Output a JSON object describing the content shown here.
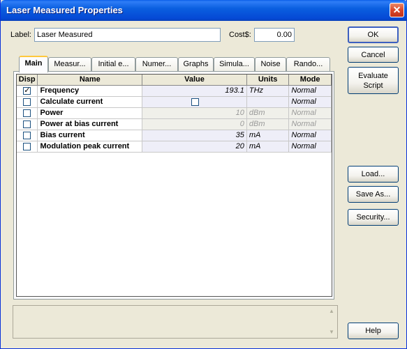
{
  "window": {
    "title": "Laser Measured Properties",
    "close": "✕"
  },
  "form": {
    "label_caption": "Label:",
    "label_value": "Laser Measured",
    "cost_caption": "Cost$:",
    "cost_value": "0.00"
  },
  "buttons": {
    "ok": "OK",
    "cancel": "Cancel",
    "evaluate": "Evaluate Script",
    "load": "Load...",
    "save_as": "Save As...",
    "security": "Security...",
    "help": "Help"
  },
  "tabs": [
    {
      "label": "Main"
    },
    {
      "label": "Measur..."
    },
    {
      "label": "Initial e..."
    },
    {
      "label": "Numer..."
    },
    {
      "label": "Graphs"
    },
    {
      "label": "Simula..."
    },
    {
      "label": "Noise"
    },
    {
      "label": "Rando..."
    }
  ],
  "table": {
    "headers": [
      "Disp",
      "Name",
      "Value",
      "Units",
      "Mode"
    ],
    "rows": [
      {
        "checked": true,
        "name": "Frequency",
        "value": "193.1",
        "units": "THz",
        "mode": "Normal",
        "disabled": false,
        "value_is_checkbox": false
      },
      {
        "checked": false,
        "name": "Calculate current",
        "value": "",
        "units": "",
        "mode": "Normal",
        "disabled": false,
        "value_is_checkbox": true
      },
      {
        "checked": false,
        "name": "Power",
        "value": "10",
        "units": "dBm",
        "mode": "Normal",
        "disabled": true,
        "value_is_checkbox": false
      },
      {
        "checked": false,
        "name": "Power at bias current",
        "value": "0",
        "units": "dBm",
        "mode": "Normal",
        "disabled": true,
        "value_is_checkbox": false
      },
      {
        "checked": false,
        "name": "Bias current",
        "value": "35",
        "units": "mA",
        "mode": "Normal",
        "disabled": false,
        "value_is_checkbox": false
      },
      {
        "checked": false,
        "name": "Modulation peak current",
        "value": "20",
        "units": "mA",
        "mode": "Normal",
        "disabled": false,
        "value_is_checkbox": false
      }
    ]
  },
  "scroll_icons": {
    "up": "▲",
    "down": "▼"
  }
}
